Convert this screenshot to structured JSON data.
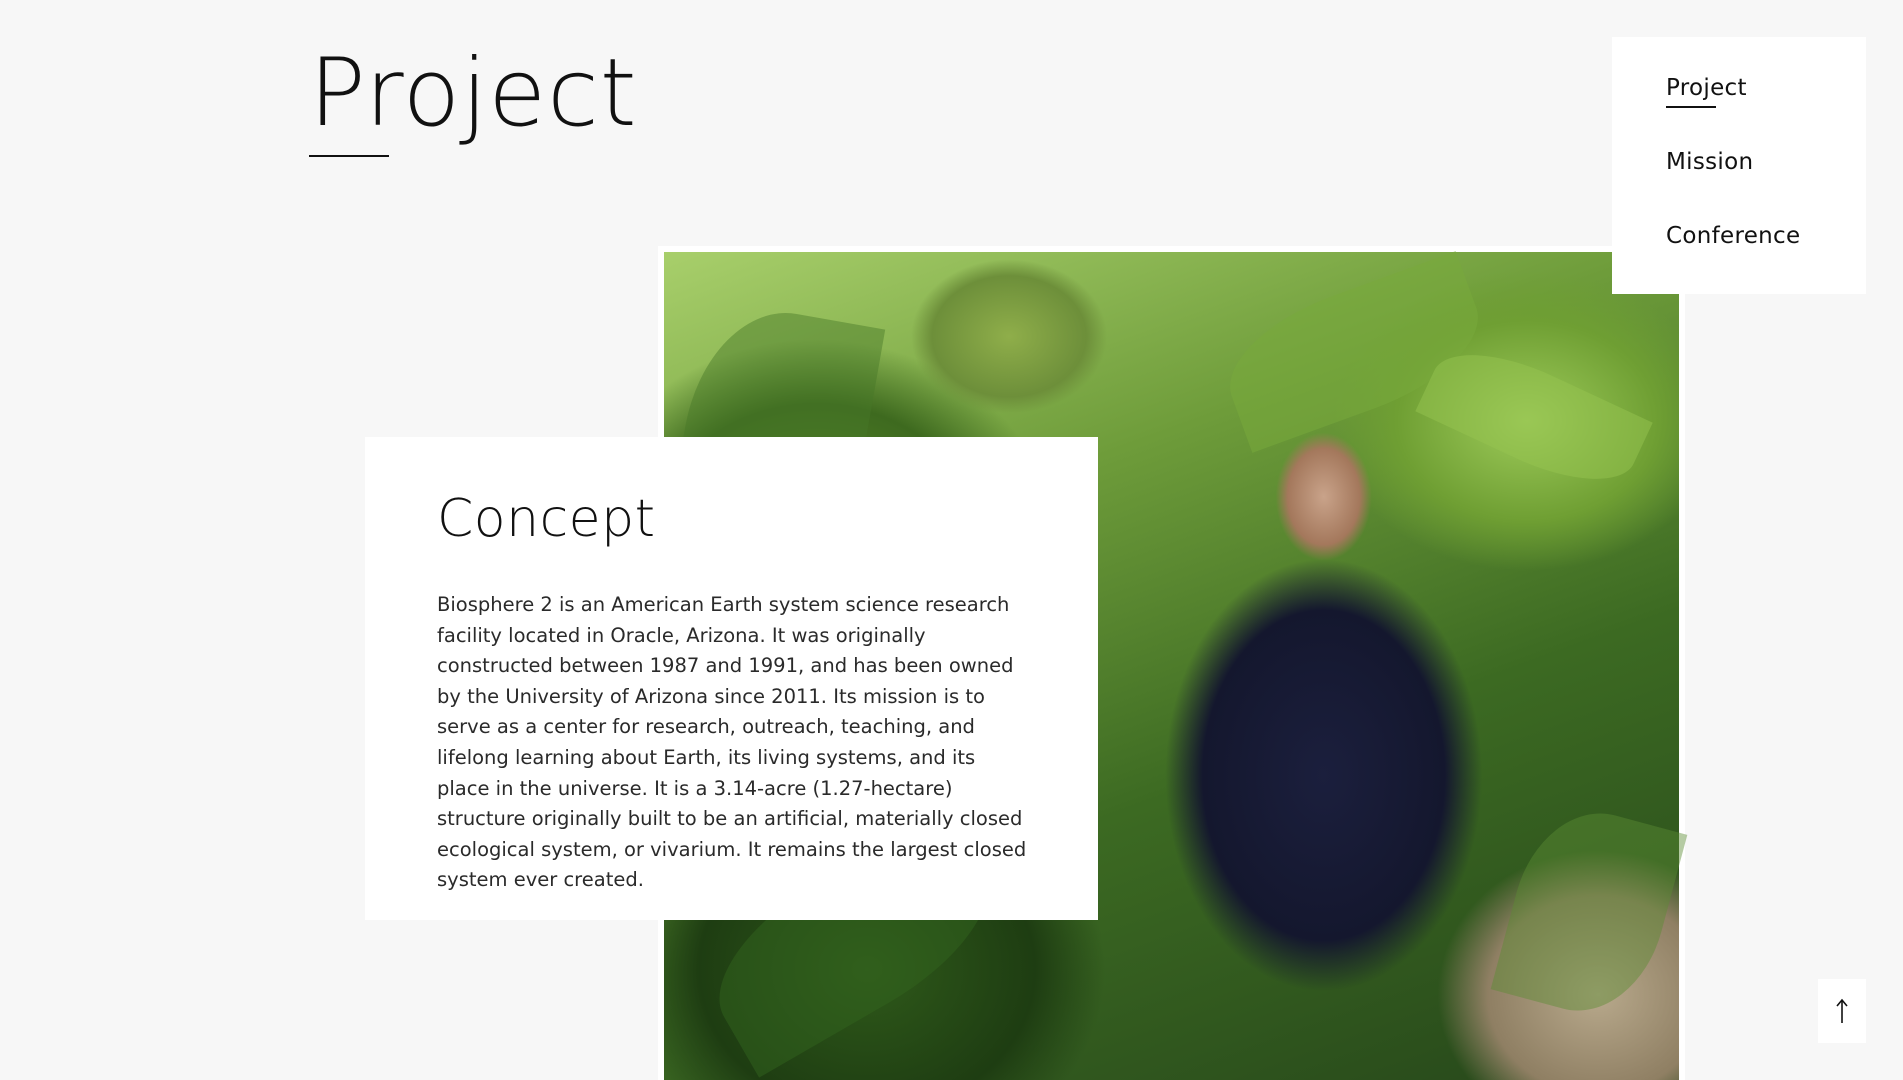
{
  "page": {
    "title": "Project"
  },
  "nav": {
    "items": [
      {
        "label": "Project",
        "active": true
      },
      {
        "label": "Mission",
        "active": false
      },
      {
        "label": "Conference",
        "active": false
      }
    ]
  },
  "concept": {
    "heading": "Concept",
    "body": "Biosphere 2 is an American Earth system science research facility located in Oracle, Arizona. It was originally constructed between 1987 and 1991, and has been owned by the University of Arizona since 2011. Its mission is to serve as a center for research, outreach, teaching, and lifelong learning about Earth, its living systems, and its place in the universe. It is a 3.14-acre (1.27-hectare) structure originally built to be an artificial, materially closed ecological system, or vivarium. It remains the largest closed system ever created."
  },
  "scroll_top": {
    "icon": "arrow-up-icon"
  }
}
